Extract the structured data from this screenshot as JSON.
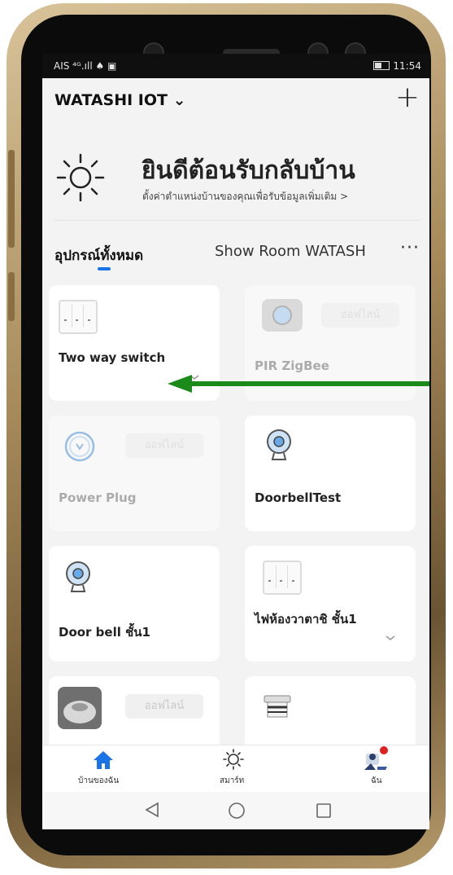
{
  "status_bar": {
    "carrier": "AIS ⁴ᴳ.ıll ♠ ▣",
    "time": "11:54"
  },
  "header": {
    "home_name": "WATASHI IOT ⌄",
    "add_icon": "plus-icon"
  },
  "welcome": {
    "title": "ยินดีต้อนรับกลับบ้าน",
    "subtitle": "ตั้งค่าตำแหน่งบ้านของคุณเพื่อรับข้อมูลเพิ่มเติม >"
  },
  "tabs": {
    "all": "อุปกรณ์ทั้งหมด",
    "room": "Show Room WATASH",
    "more": "···"
  },
  "devices": [
    {
      "name": "Two way switch",
      "icon": "switch-icon",
      "offline": false
    },
    {
      "name": "PIR ZigBee",
      "icon": "pir-camera-icon",
      "offline": true,
      "offline_label": "ออฟไลน์"
    },
    {
      "name": "Power Plug",
      "icon": "power-plug-icon",
      "offline": true,
      "offline_label": "ออฟไลน์"
    },
    {
      "name": "DoorbellTest",
      "icon": "doorbell-camera-icon",
      "offline": false
    },
    {
      "name": "Door bell ชั้น1",
      "icon": "doorbell-camera-icon",
      "offline": false
    },
    {
      "name": "ไฟห้องวาตาชิ ชั้น1",
      "icon": "switch-icon",
      "offline": false
    },
    {
      "name": "",
      "icon": "speaker-icon",
      "offline": true,
      "offline_label": "ออฟไลน์"
    },
    {
      "name": "",
      "icon": "smoke-detector-icon",
      "offline": false
    }
  ],
  "bottom_nav": {
    "home": "บ้านของฉัน",
    "smart": "สมาร์ท",
    "me": "ฉัน"
  },
  "colors": {
    "accent": "#1a73e8",
    "arrow": "#1a8a1a"
  }
}
